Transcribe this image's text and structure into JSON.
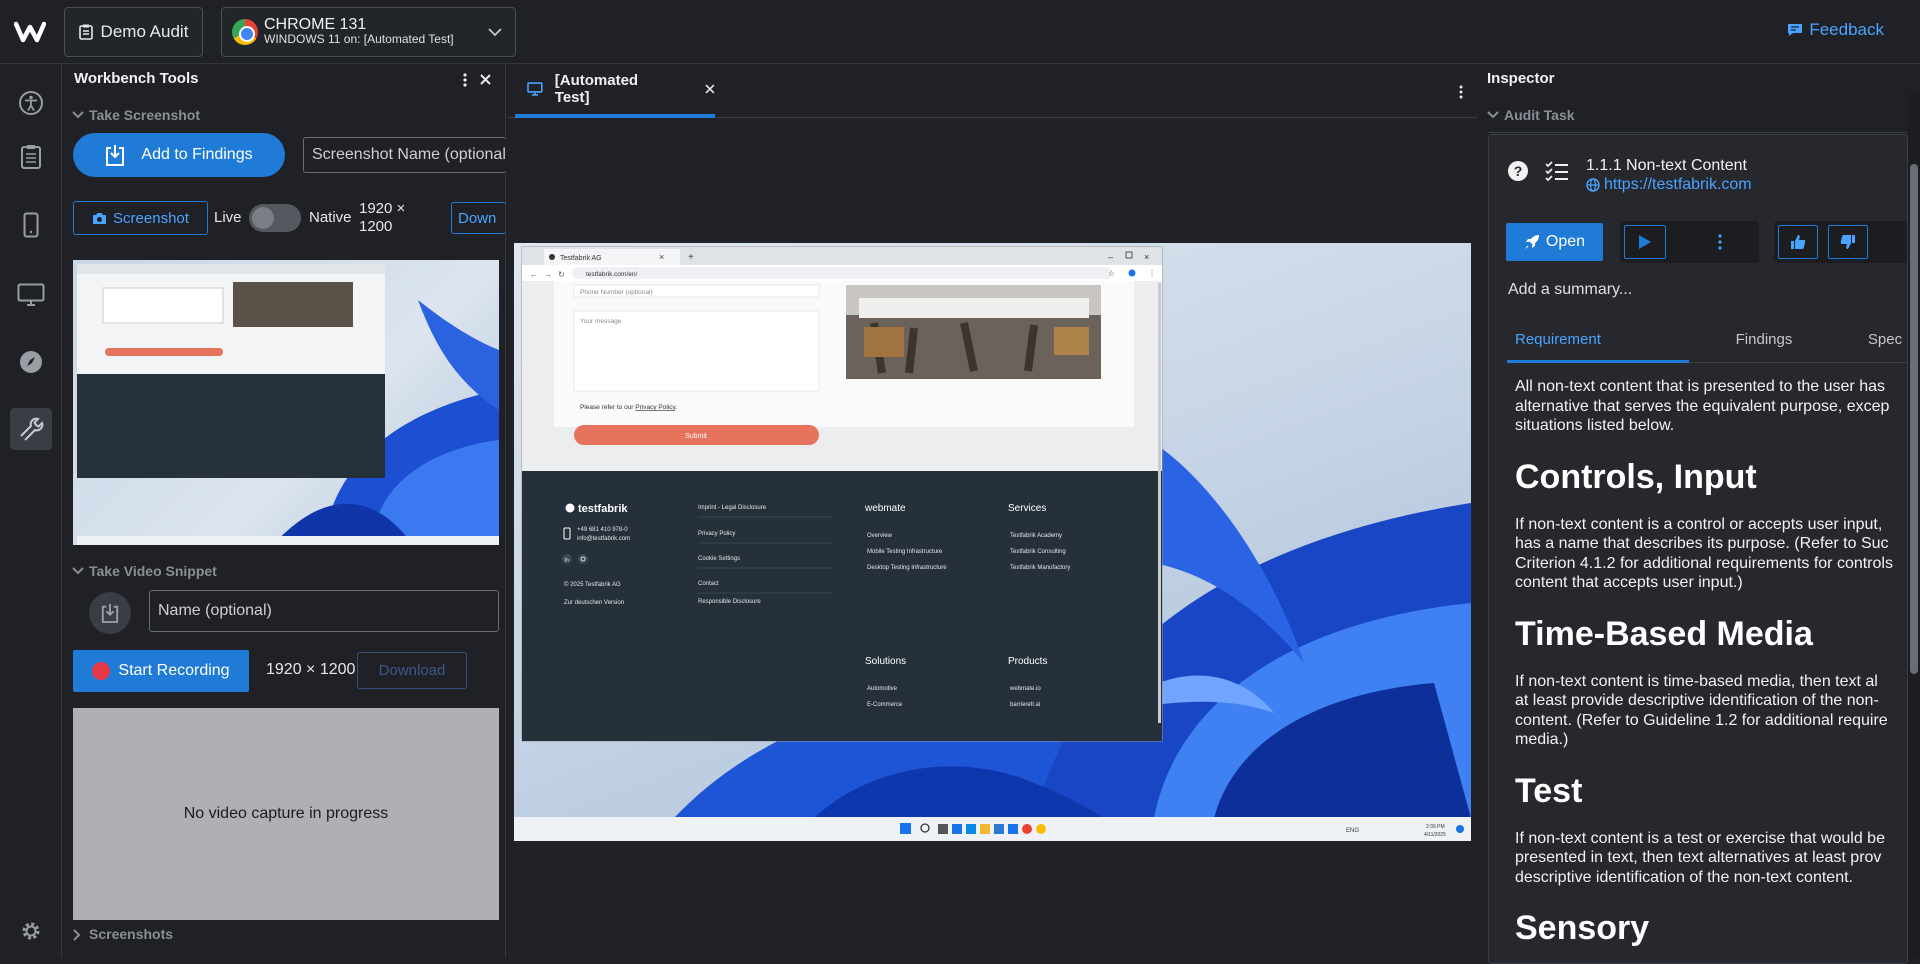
{
  "header": {
    "audit_label": "Demo Audit",
    "browser_name": "CHROME 131",
    "browser_os": "WINDOWS 11 on: [Automated Test]",
    "feedback_label": "Feedback"
  },
  "workbench": {
    "title": "Workbench Tools",
    "screenshot_section": "Take Screenshot",
    "add_to_findings": "Add to Findings",
    "screenshot_name_placeholder": "Screenshot Name (optional)",
    "screenshot_button": "Screenshot",
    "live_label": "Live",
    "native_label": "Native",
    "resolution_line1": "1920 ×",
    "resolution_line2": "1200",
    "download_label": "Down",
    "video_section": "Take Video Snippet",
    "video_name_placeholder": "Name (optional)",
    "start_recording": "Start Recording",
    "video_resolution": "1920 × 1200",
    "video_download": "Download",
    "no_video": "No video capture in progress",
    "screenshots_section": "Screenshots"
  },
  "session": {
    "tab_title": "[Automated Test]"
  },
  "remote_page": {
    "tab_label": "Testfabrik AG",
    "url": "testfabrik.com/en/",
    "phone_placeholder": "Phone Number (optional)",
    "message_placeholder": "Your message",
    "privacy_prefix": "Please refer to our ",
    "privacy_link": "Privacy Policy",
    "privacy_suffix": ".",
    "submit": "Submit",
    "brand": "testfabrik",
    "phone": "+49 681 410 978-0",
    "email": "info@testfabrik.com",
    "copyright": "© 2025 Testfabrik AG",
    "german_version": "Zur deutschen Version",
    "footer_links": [
      "Imprint - Legal Disclosure",
      "Privacy Policy",
      "Cookie Settings",
      "Contact",
      "Responsible Disclosure"
    ],
    "webmate_heading": "webmate",
    "webmate_links": [
      "Overview",
      "Mobile Testing Infrastructure",
      "Desktop Testing Infrastructure"
    ],
    "services_heading": "Services",
    "services_links": [
      "Testfabrik Academy",
      "Testfabrik Consulting",
      "Testfabrik Manufactory"
    ],
    "solutions_heading": "Solutions",
    "solutions_links": [
      "Automotive",
      "E-Commerce"
    ],
    "products_heading": "Products",
    "products_links": [
      "webmate.io",
      "barrierefr.ai"
    ],
    "taskbar_lang": "ENG",
    "taskbar_time": "2:39 PM",
    "taskbar_date": "4/11/2025"
  },
  "inspector": {
    "title": "Inspector",
    "audit_task_section": "Audit Task",
    "criterion": "1.1.1 Non-text Content",
    "url": "https://testfabrik.com",
    "open_label": "Open",
    "summary_placeholder": "Add a summary...",
    "tabs": [
      "Requirement",
      "Findings",
      "Spec"
    ],
    "requirement": {
      "intro": [
        "All non-text content that is presented to the user has",
        "alternative that serves the equivalent purpose, excep",
        "situations listed below."
      ],
      "h1": "Controls, Input",
      "p1": [
        "If non-text content is a control or accepts user input,",
        "has a name that describes its purpose. (Refer to Suc",
        "Criterion 4.1.2 for additional requirements for controls",
        "content that accepts user input.)"
      ],
      "h2": "Time-Based Media",
      "p2": [
        "If non-text content is time-based media, then text al",
        "at least provide descriptive identification of the non-",
        "content. (Refer to Guideline 1.2 for additional require",
        "media.)"
      ],
      "h3": "Test",
      "p3": [
        "If non-text content is a test or exercise that would be",
        "presented in text, then text alternatives at least prov",
        "descriptive identification of the non-text content."
      ],
      "h4": "Sensory"
    }
  },
  "colors": {
    "accent": "#1f7bd6",
    "record": "#e53948",
    "submit": "#e8735c"
  }
}
